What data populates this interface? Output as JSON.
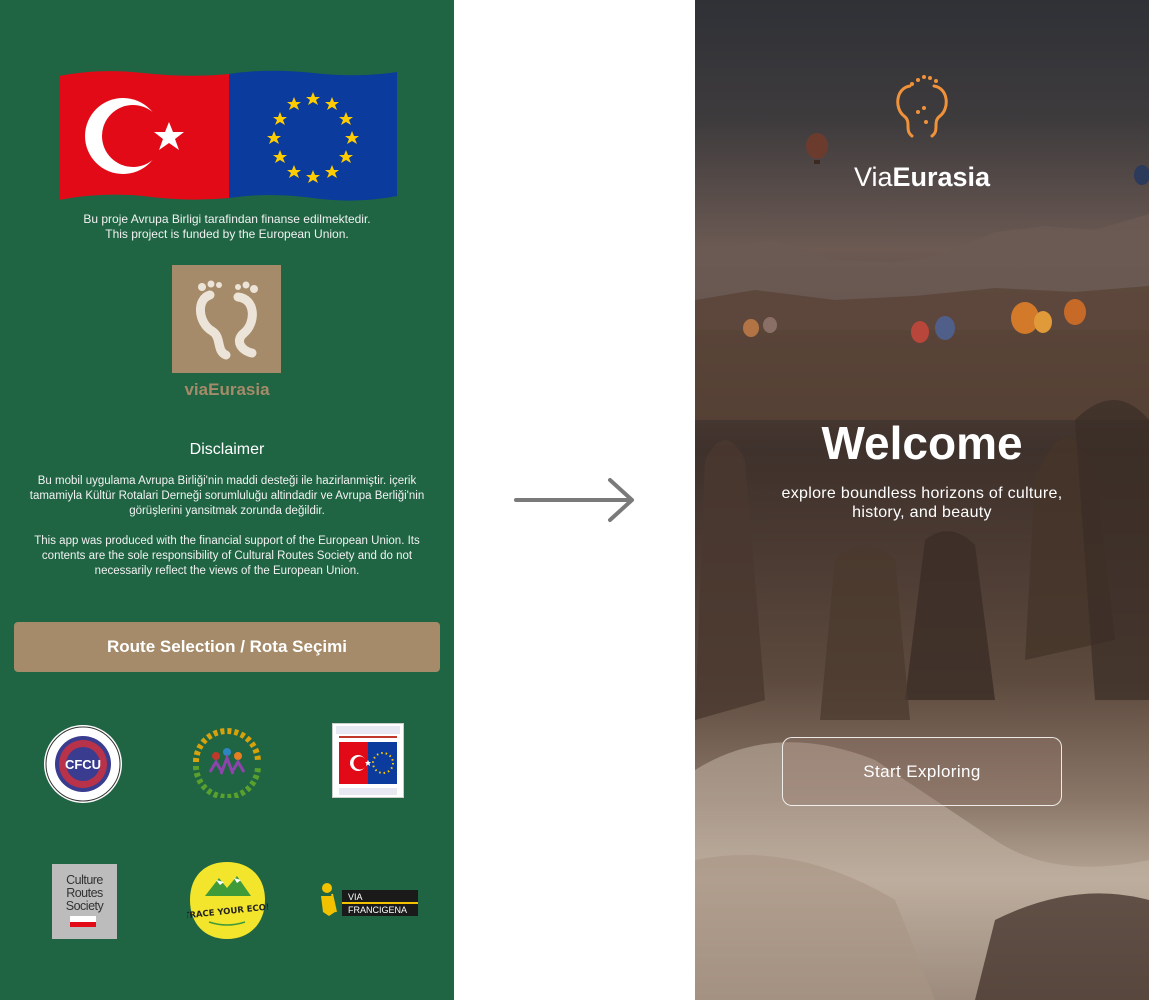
{
  "left": {
    "funding_tr": "Bu proje Avrupa Birligi tarafindan finanse edilmektedir.",
    "funding_en": "This project is funded by the European Union.",
    "logo_name": "viaEurasia",
    "disclaimer_title": "Disclaimer",
    "disclaimer_tr": "Bu mobil uygulama Avrupa Birliği'nin maddi desteği ile hazirlanmiştir. içerik tamamiyla Kültür Rotalari Derneği sorumluluğu altindadir ve Avrupa Berliği'nin görüşlerini yansitmak zorunda değildir.",
    "disclaimer_en": "This app was produced with the financial support of the European Union. Its contents are the sole responsibility of Cultural Routes Society and do not necessarily reflect the views of the European Union.",
    "route_button": "Route Selection / Rota Seçimi",
    "partners": {
      "cfcu": "CFCU",
      "crs_line1": "Culture",
      "crs_line2": "Routes",
      "crs_line3": "Society",
      "tye": "TRACE YOUR ECO!",
      "vf_line1": "VIA",
      "vf_line2": "FRANCIGENA"
    }
  },
  "right": {
    "brand_light": "Via",
    "brand_bold": "Eurasia",
    "welcome": "Welcome",
    "tagline": "explore boundless horizons of culture, history, and beauty",
    "start_button": "Start Exploring"
  },
  "colors": {
    "left_bg": "#1f6443",
    "accent_tan": "#a58b69",
    "brand_orange": "#f0923a",
    "flag_red": "#e30a17",
    "eu_blue": "#0b3b9c",
    "eu_star": "#ffcc00"
  }
}
